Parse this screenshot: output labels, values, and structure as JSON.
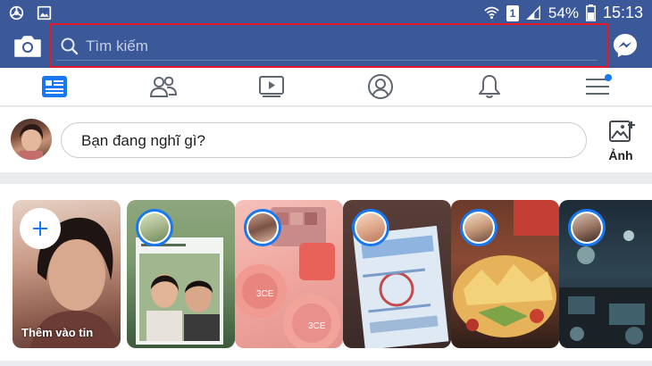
{
  "status_bar": {
    "battery": "54%",
    "time": "15:13",
    "sim_slot": "1",
    "icons": [
      "chrome-icon",
      "gallery-icon",
      "wifi-icon",
      "sim-icon",
      "signal-icon",
      "battery-icon"
    ]
  },
  "app_bar": {
    "search_placeholder": "Tìm kiếm",
    "icons": [
      "camera-icon",
      "search-icon",
      "messenger-icon"
    ],
    "search_highlight_color": "#e0192b",
    "brand_color": "#3b5998"
  },
  "tabs": [
    {
      "name": "news-feed",
      "icon": "news-feed-icon",
      "active": true
    },
    {
      "name": "friends",
      "icon": "friends-icon",
      "active": false
    },
    {
      "name": "watch",
      "icon": "watch-icon",
      "active": false
    },
    {
      "name": "profile",
      "icon": "profile-icon",
      "active": false
    },
    {
      "name": "notifications",
      "icon": "bell-icon",
      "active": false
    },
    {
      "name": "menu",
      "icon": "menu-icon",
      "active": false,
      "badge": true
    }
  ],
  "composer": {
    "placeholder": "Bạn đang nghĩ gì?",
    "photo_label": "Ảnh"
  },
  "stories": {
    "add_label": "Thêm vào tin",
    "items": [
      {
        "kind": "create"
      },
      {
        "kind": "story"
      },
      {
        "kind": "story"
      },
      {
        "kind": "story"
      },
      {
        "kind": "story"
      },
      {
        "kind": "story"
      }
    ]
  }
}
